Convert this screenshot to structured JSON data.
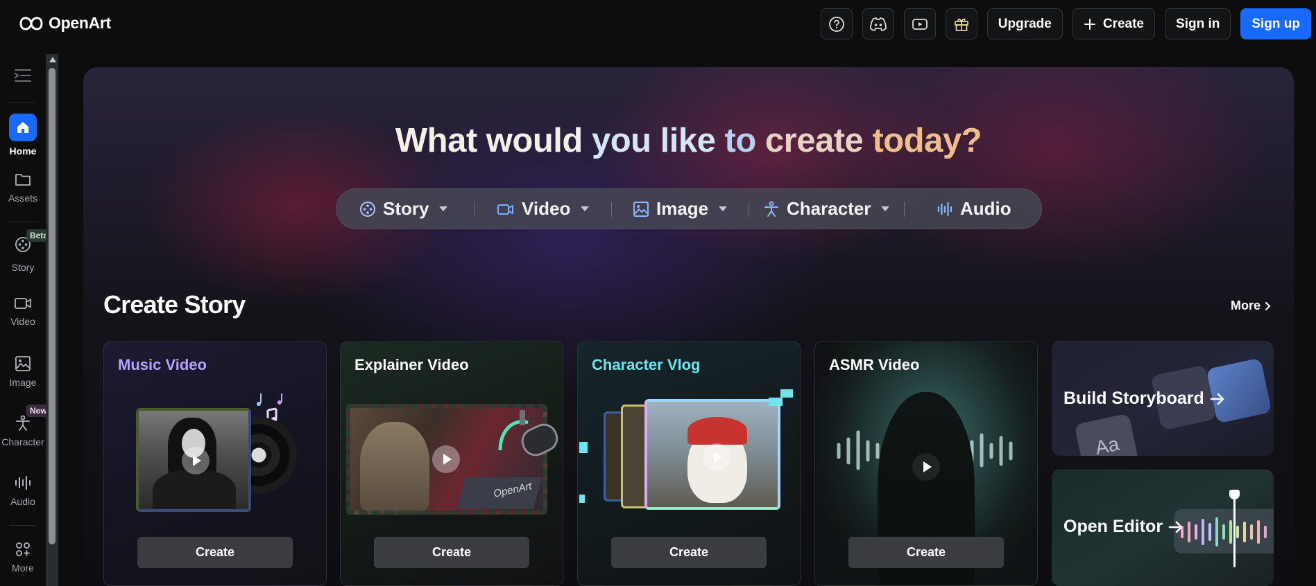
{
  "brand": {
    "name": "OpenArt"
  },
  "topnav": {
    "help_icon": "question-circle-icon",
    "discord_icon": "discord-icon",
    "youtube_icon": "youtube-icon",
    "gift_icon": "gift-icon",
    "upgrade_label": "Upgrade",
    "create_label": "Create",
    "signin_label": "Sign in",
    "signup_label": "Sign up"
  },
  "sidebar": {
    "items": [
      {
        "label": "Home",
        "icon": "home-icon",
        "active": true
      },
      {
        "label": "Assets",
        "icon": "folder-icon"
      },
      {
        "label": "Story",
        "icon": "film-reel-icon",
        "badge": "Beta"
      },
      {
        "label": "Video",
        "icon": "video-camera-icon"
      },
      {
        "label": "Image",
        "icon": "image-icon"
      },
      {
        "label": "Character",
        "icon": "character-icon",
        "badge": "New"
      },
      {
        "label": "Audio",
        "icon": "audio-wave-icon"
      },
      {
        "label": "More",
        "icon": "grid-icon"
      }
    ]
  },
  "hero": {
    "title_parts": [
      "What would",
      "you like",
      "to",
      "create",
      "today?"
    ],
    "tabs": [
      {
        "label": "Story",
        "icon": "film-reel-icon"
      },
      {
        "label": "Video",
        "icon": "video-camera-icon"
      },
      {
        "label": "Image",
        "icon": "image-icon"
      },
      {
        "label": "Character",
        "icon": "character-icon"
      },
      {
        "label": "Audio",
        "icon": "audio-wave-icon"
      }
    ]
  },
  "section": {
    "title": "Create Story",
    "more_label": "More",
    "cards": [
      {
        "title": "Music Video",
        "button": "Create",
        "title_color": "#b7a2ff"
      },
      {
        "title": "Explainer Video",
        "button": "Create",
        "title_color": "#ffffff"
      },
      {
        "title": "Character Vlog",
        "button": "Create",
        "title_color": "#6fe3ee"
      },
      {
        "title": "ASMR Video",
        "button": "Create",
        "title_color": "#ffffff"
      }
    ],
    "side_cards": [
      {
        "title": "Build Storyboard"
      },
      {
        "title": "Open Editor"
      }
    ],
    "watermark": "OpenArt"
  },
  "colors": {
    "accent": "#1769ff",
    "background": "#0d0d0e"
  }
}
